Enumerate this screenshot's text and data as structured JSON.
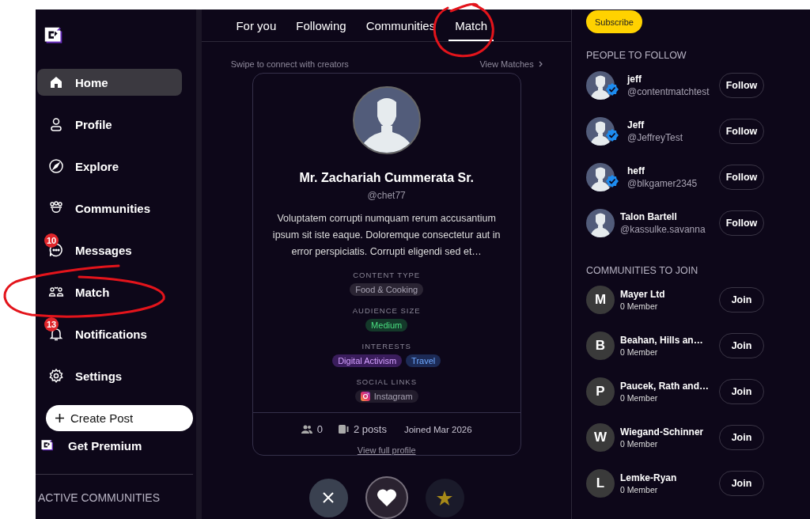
{
  "sidebar": {
    "nav": [
      {
        "label": "Home",
        "selected": true
      },
      {
        "label": "Profile",
        "selected": false
      },
      {
        "label": "Explore",
        "selected": false
      },
      {
        "label": "Communities",
        "selected": false
      },
      {
        "label": "Messages",
        "selected": false,
        "badge": "10"
      },
      {
        "label": "Match",
        "selected": false,
        "circled": true
      },
      {
        "label": "Notifications",
        "selected": false,
        "badge": "13"
      },
      {
        "label": "Settings",
        "selected": false
      }
    ],
    "create_post": "Create Post",
    "premium": "Get Premium",
    "section_title": "ACTIVE COMMUNITIES"
  },
  "tabs": [
    {
      "label": "For you",
      "selected": false
    },
    {
      "label": "Following",
      "selected": false
    },
    {
      "label": "Communities",
      "selected": false
    },
    {
      "label": "Match",
      "selected": true,
      "circled": true
    }
  ],
  "match": {
    "hint": "Swipe to connect with creators",
    "view_matches": "View Matches",
    "profile": {
      "name": "Mr. Zachariah Cummerata Sr.",
      "handle": "@chet77",
      "bio": "Voluptatem corrupti numquam rerum accusantium ipsum sit iste eaque. Doloremque consectetur aut in error perspiciatis. Corrupti eligendi sed et…",
      "sections": [
        {
          "title": "CONTENT TYPE",
          "tags": [
            {
              "label": "Food & Cooking",
              "color": "#2a2433"
            }
          ]
        },
        {
          "title": "AUDIENCE SIZE",
          "tags": [
            {
              "label": "Medium",
              "color": "#14392a"
            }
          ]
        },
        {
          "title": "INTERESTS",
          "tags": [
            {
              "label": "Digital Activism",
              "color": "#3a1d5c"
            },
            {
              "label": "Travel",
              "color": "#1c2a55"
            }
          ]
        },
        {
          "title": "SOCIAL LINKS",
          "tags": [
            {
              "label": "Instagram",
              "color": "#221c2c",
              "kind": "instagram"
            }
          ]
        }
      ],
      "followers": "0",
      "posts": "2 posts",
      "joined": "Joined Mar 2026",
      "view_profile": "View full profile"
    },
    "actions": [
      {
        "kind": "pass"
      },
      {
        "kind": "like"
      },
      {
        "kind": "super"
      }
    ]
  },
  "right": {
    "subscribe": "Subscribe",
    "people_title": "PEOPLE TO FOLLOW",
    "people": [
      {
        "name": "jeff",
        "handle": "@contentmatchtest",
        "verified": true,
        "button": "Follow"
      },
      {
        "name": "Jeff",
        "handle": "@JeffreyTest",
        "verified": true,
        "button": "Follow"
      },
      {
        "name": "heff",
        "handle": "@blkgamer2345",
        "verified": true,
        "button": "Follow"
      },
      {
        "name": "Talon Bartell",
        "handle": "@kassulke.savanna",
        "verified": false,
        "button": "Follow"
      }
    ],
    "communities_title": "COMMUNITIES TO JOIN",
    "communities": [
      {
        "initial": "M",
        "name": "Mayer Ltd",
        "members": "0 Member",
        "button": "Join"
      },
      {
        "initial": "B",
        "name": "Beahan, Hills an…",
        "members": "0 Member",
        "button": "Join"
      },
      {
        "initial": "P",
        "name": "Paucek, Rath and…",
        "members": "0 Member",
        "button": "Join"
      },
      {
        "initial": "W",
        "name": "Wiegand-Schinner",
        "members": "0 Member",
        "button": "Join"
      },
      {
        "initial": "L",
        "name": "Lemke-Ryan",
        "members": "0 Member",
        "button": "Join"
      }
    ]
  }
}
